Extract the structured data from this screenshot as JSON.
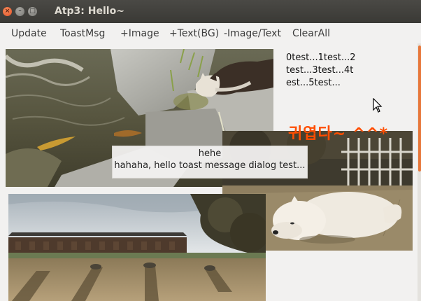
{
  "window": {
    "title": "Atp3: Hello~"
  },
  "menu": {
    "items": [
      "Update",
      "ToastMsg",
      "+Image",
      "+Text(BG)",
      "-Image/Text",
      "ClearAll"
    ]
  },
  "canvas": {
    "text_lines": [
      "0test...1test...2",
      "test...3test...4t",
      "est...5test..."
    ],
    "korean_text": "귀엽다~ ^^*",
    "images": [
      "creek-cat-photo",
      "white-dog-photo",
      "palace-yard-photo"
    ]
  },
  "toast": {
    "title": "hehe",
    "message": "hahaha, hello toast message dialog test..."
  },
  "colors": {
    "titlebar": "#3c3b37",
    "accent": "#e7773a",
    "korean_text": "#ff4d00"
  }
}
